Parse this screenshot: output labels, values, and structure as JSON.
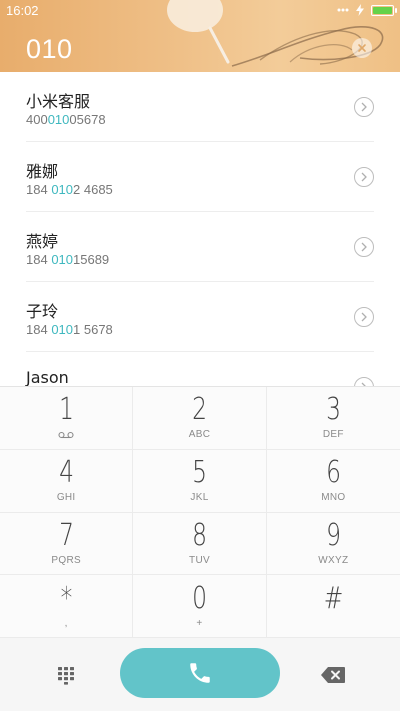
{
  "status_bar": {
    "time": "16:02",
    "battery_color": "#64d24a"
  },
  "dialer": {
    "input_value": "010"
  },
  "contacts": [
    {
      "name": "小米客服",
      "number_pre": "400",
      "number_match": "010",
      "number_post": "05678"
    },
    {
      "name": "雅娜",
      "number_pre": "184 ",
      "number_match": "010",
      "number_post": "2 4685"
    },
    {
      "name": "燕婷",
      "number_pre": "184 ",
      "number_match": "010",
      "number_post": "15689"
    },
    {
      "name": "子玲",
      "number_pre": "184 ",
      "number_match": "010",
      "number_post": "1 5678"
    },
    {
      "name": "Jason",
      "number_pre": "",
      "number_match": "",
      "number_post": ""
    }
  ],
  "keypad": {
    "keys": [
      {
        "digit": "1",
        "letters": "",
        "icon": "voicemail-icon"
      },
      {
        "digit": "2",
        "letters": "ABC"
      },
      {
        "digit": "3",
        "letters": "DEF"
      },
      {
        "digit": "4",
        "letters": "GHI"
      },
      {
        "digit": "5",
        "letters": "JKL"
      },
      {
        "digit": "6",
        "letters": "MNO"
      },
      {
        "digit": "7",
        "letters": "PQRS"
      },
      {
        "digit": "8",
        "letters": "TUV"
      },
      {
        "digit": "9",
        "letters": "WXYZ"
      },
      {
        "digit": "*",
        "letters": ","
      },
      {
        "digit": "0",
        "letters": "+"
      },
      {
        "digit": "#",
        "letters": ""
      }
    ]
  },
  "bottom_bar": {
    "keypad_toggle_icon": "dialpad-grid-icon",
    "call_icon": "phone-icon",
    "backspace_icon": "backspace-icon",
    "call_button_color": "#62c4c9"
  },
  "colors": {
    "match_highlight": "#3fb8bf",
    "header_accent": "#efc088"
  }
}
